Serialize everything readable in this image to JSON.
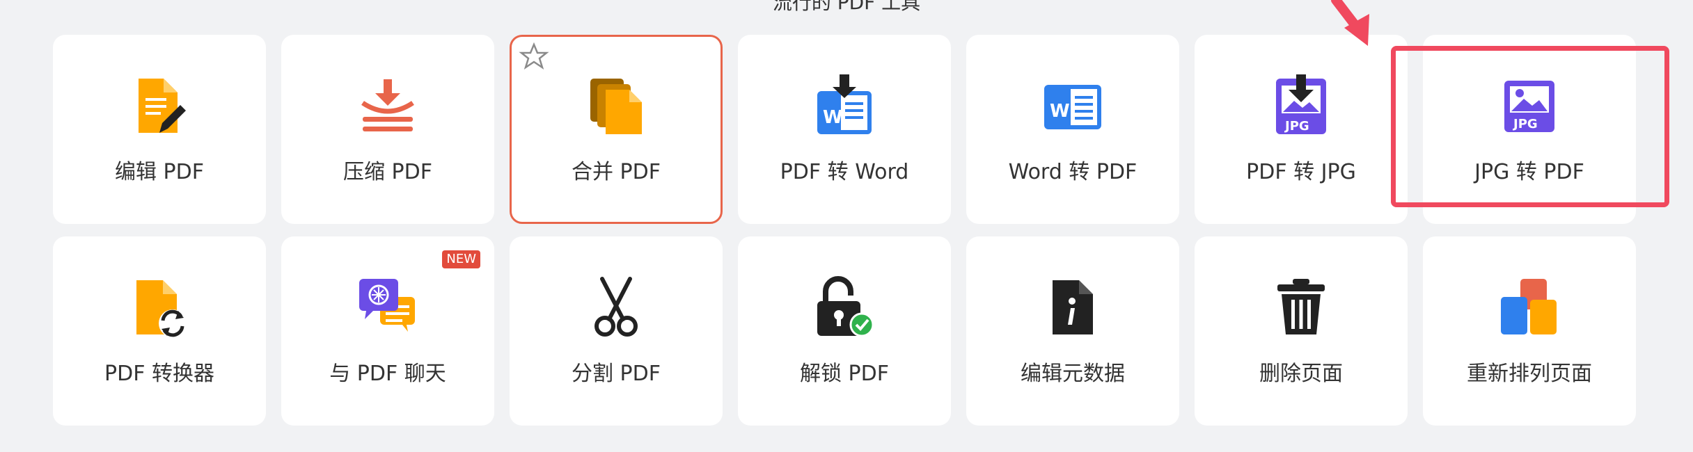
{
  "section_title": "流行的 PDF 工具",
  "tools_row1": [
    {
      "label": "编辑 PDF"
    },
    {
      "label": "压缩 PDF"
    },
    {
      "label": "合并 PDF"
    },
    {
      "label": "PDF 转 Word"
    },
    {
      "label": "Word 转 PDF"
    },
    {
      "label": "PDF 转 JPG"
    },
    {
      "label": "JPG 转 PDF"
    }
  ],
  "tools_row2": [
    {
      "label": "PDF 转换器"
    },
    {
      "label": "与 PDF 聊天",
      "badge": "NEW"
    },
    {
      "label": "分割 PDF"
    },
    {
      "label": "解锁 PDF"
    },
    {
      "label": "编辑元数据"
    },
    {
      "label": "删除页面"
    },
    {
      "label": "重新排列页面"
    }
  ],
  "colors": {
    "accent_orange": "#ffa700",
    "accent_red": "#e8654a",
    "word_blue": "#2f80ed",
    "jpg_purple": "#6b4de6",
    "highlight": "#f0495e"
  }
}
